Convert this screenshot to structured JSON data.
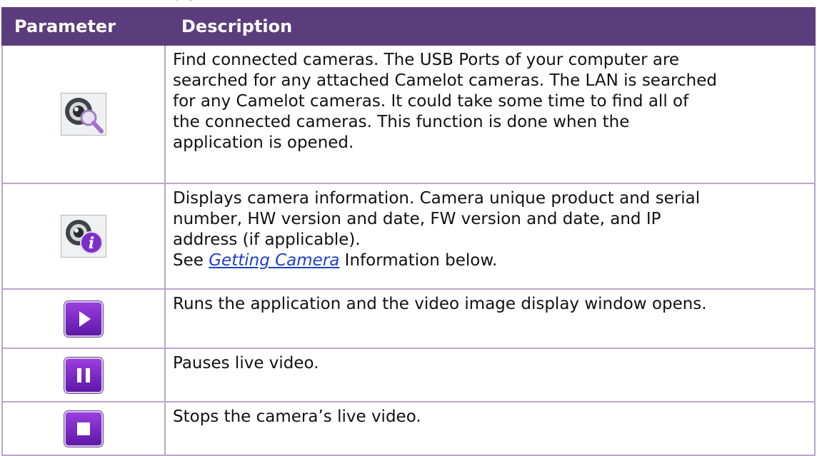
{
  "table": {
    "headers": {
      "parameter": "Parameter",
      "description": "Description"
    },
    "rows": [
      {
        "icon": "find-cameras-icon",
        "lines": [
          "Find connected cameras. The USB Ports of your computer are",
          "searched for any attached Camelot cameras. The LAN is searched",
          "for any Camelot cameras.  It could take some time to find all of",
          "the connected cameras.  This function is done when the",
          "application is opened."
        ]
      },
      {
        "icon": "camera-info-icon",
        "lines": [
          "Displays camera information. Camera unique product and serial",
          "number, HW version and date, FW version and date, and IP",
          "address (if applicable)."
        ],
        "see_prefix": "See ",
        "link_text": "Getting Camera",
        "see_suffix": " Information below."
      },
      {
        "icon": "play-icon",
        "text": "Runs the application and the video image display window opens."
      },
      {
        "icon": "pause-icon",
        "text": "Pauses live video."
      },
      {
        "icon": "stop-icon",
        "text": "Stops the camera’s live video."
      }
    ]
  },
  "colors": {
    "header_bg": "#5b3d7e",
    "border": "#b9a6cc",
    "button_purple": "#7a2bc4",
    "link": "#1f40c8"
  }
}
